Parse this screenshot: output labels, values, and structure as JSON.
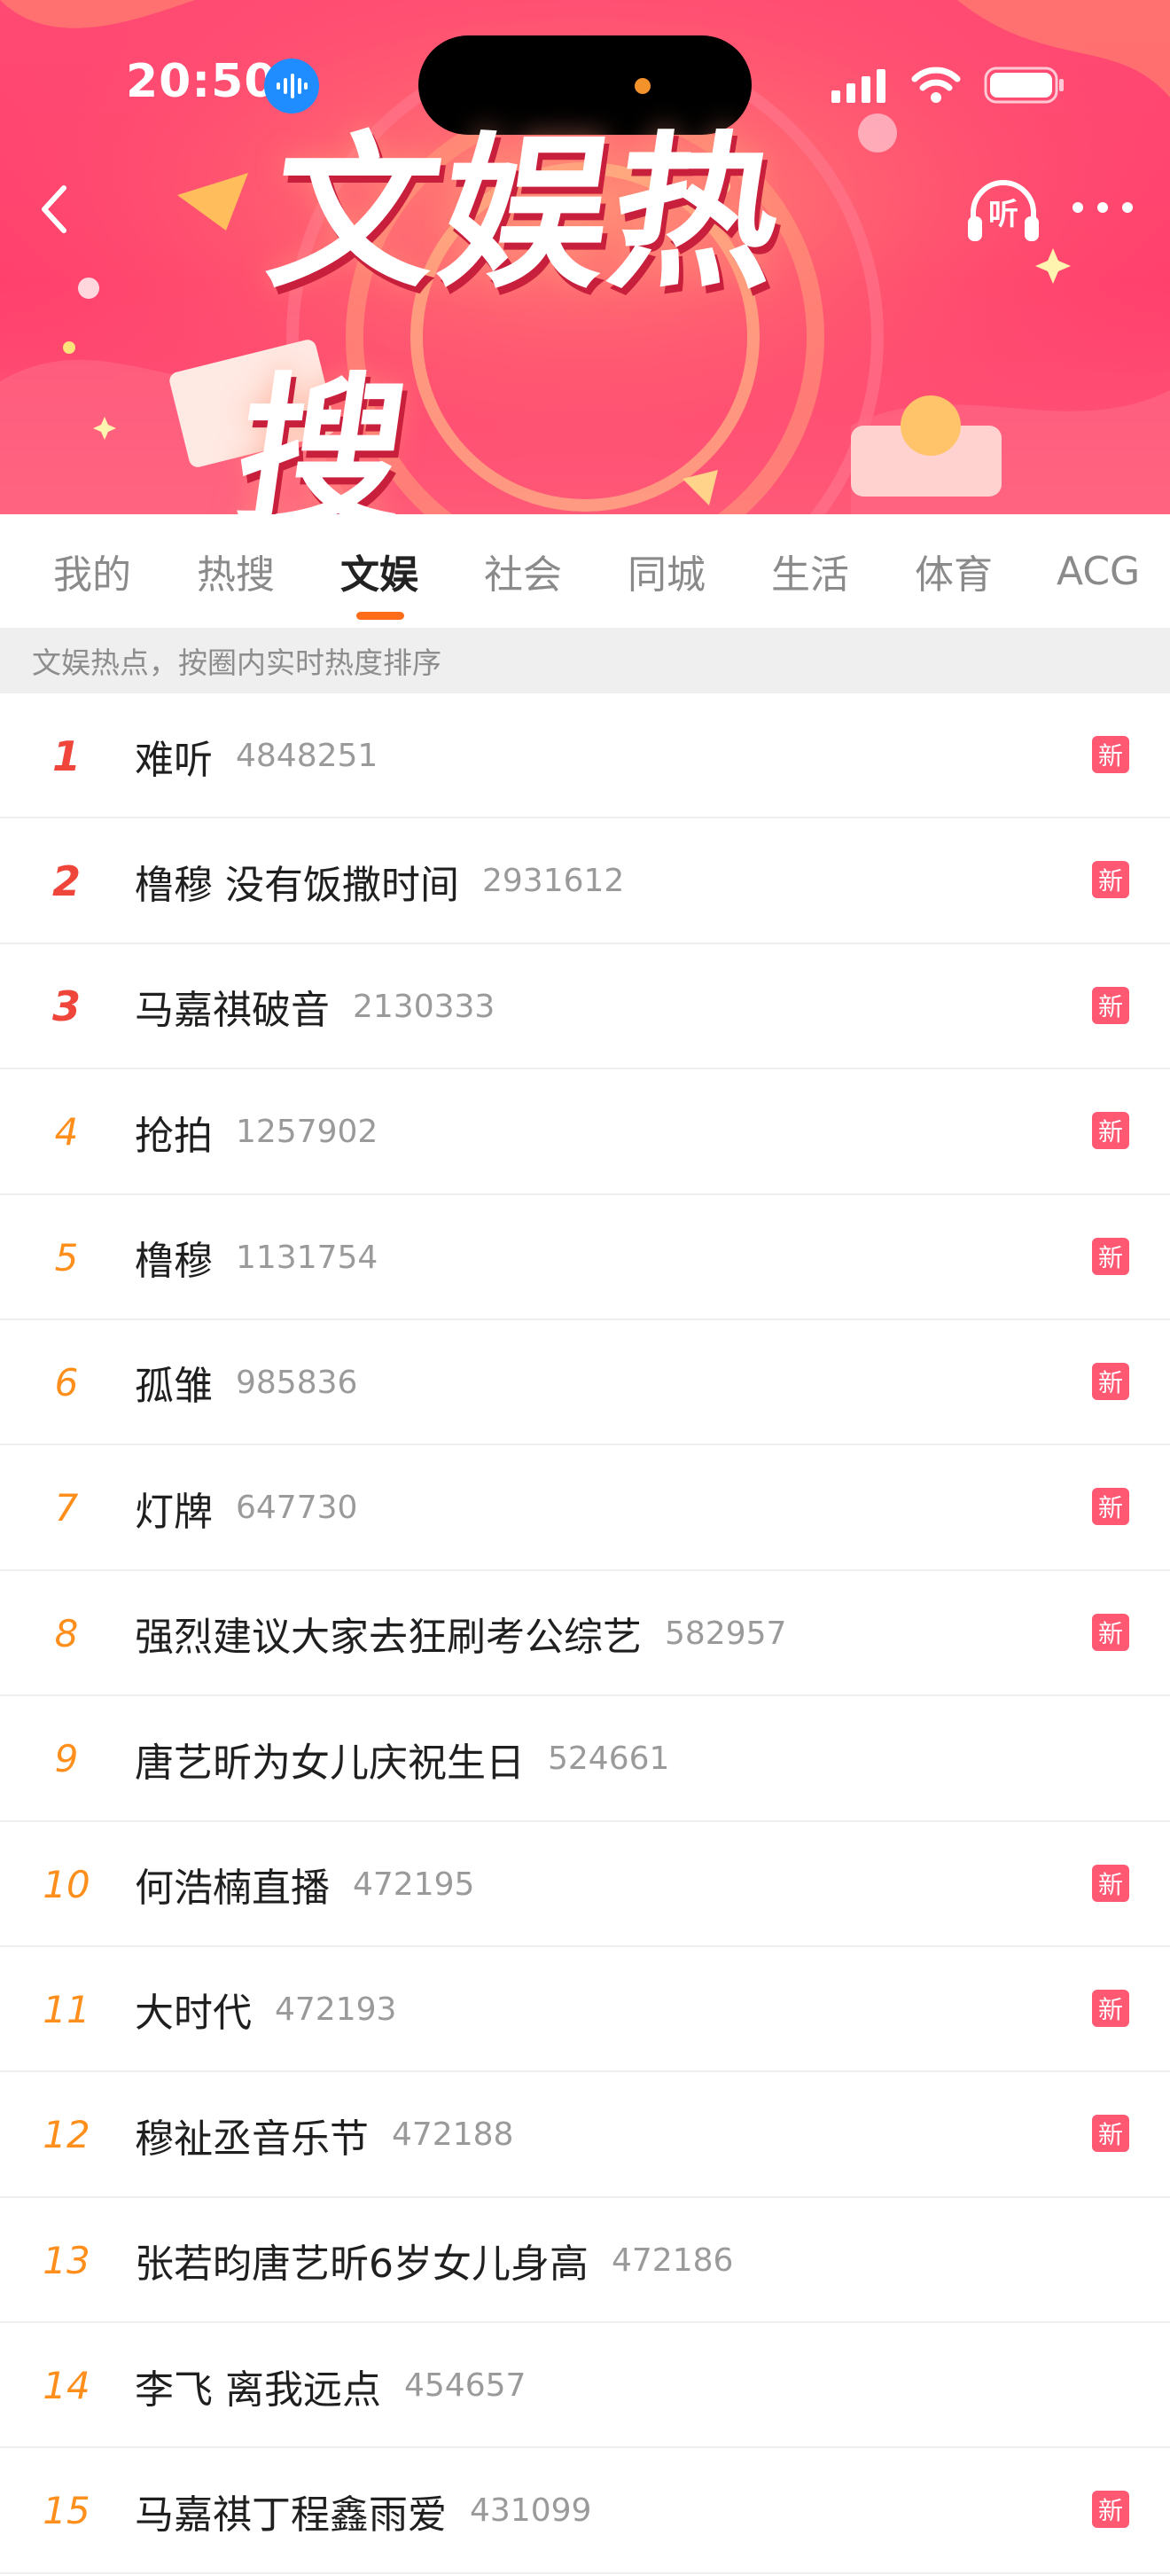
{
  "status_bar": {
    "time": "20:50",
    "icons": [
      "voice-wave-icon",
      "signal-icon",
      "wifi-icon",
      "battery-icon"
    ]
  },
  "header": {
    "title": "文娱热搜",
    "back_icon": "chevron-left-icon",
    "listen_label": "听",
    "more_icon": "more-dots-icon"
  },
  "tabs": [
    {
      "label": "我的",
      "active": false
    },
    {
      "label": "热搜",
      "active": false
    },
    {
      "label": "文娱",
      "active": true
    },
    {
      "label": "社会",
      "active": false
    },
    {
      "label": "同城",
      "active": false
    },
    {
      "label": "生活",
      "active": false
    },
    {
      "label": "体育",
      "active": false
    },
    {
      "label": "ACG",
      "active": false
    }
  ],
  "hint": "文娱热点，按圈内实时热度排序",
  "badge_label": "新",
  "items": [
    {
      "rank": "1",
      "title": "难听",
      "count": "4848251",
      "new": true
    },
    {
      "rank": "2",
      "title": "橹穆 没有饭撒时间",
      "count": "2931612",
      "new": true
    },
    {
      "rank": "3",
      "title": "马嘉祺破音",
      "count": "2130333",
      "new": true
    },
    {
      "rank": "4",
      "title": "抢拍",
      "count": "1257902",
      "new": true
    },
    {
      "rank": "5",
      "title": "橹穆",
      "count": "1131754",
      "new": true
    },
    {
      "rank": "6",
      "title": "孤雏",
      "count": "985836",
      "new": true
    },
    {
      "rank": "7",
      "title": "灯牌",
      "count": "647730",
      "new": true
    },
    {
      "rank": "8",
      "title": "强烈建议大家去狂刷考公综艺",
      "count": "582957",
      "new": true
    },
    {
      "rank": "9",
      "title": "唐艺昕为女儿庆祝生日",
      "count": "524661",
      "new": false
    },
    {
      "rank": "10",
      "title": "何浩楠直播",
      "count": "472195",
      "new": true
    },
    {
      "rank": "11",
      "title": "大时代",
      "count": "472193",
      "new": true
    },
    {
      "rank": "12",
      "title": "穆祉丞音乐节",
      "count": "472188",
      "new": true
    },
    {
      "rank": "13",
      "title": "张若昀唐艺昕6岁女儿身高",
      "count": "472186",
      "new": false
    },
    {
      "rank": "14",
      "title": "李飞 离我远点",
      "count": "454657",
      "new": false
    },
    {
      "rank": "15",
      "title": "马嘉祺丁程鑫雨爱",
      "count": "431099",
      "new": true
    }
  ],
  "colors": {
    "banner": "#ff4a73",
    "top_rank": "#f0453a",
    "rank": "#ff8f1c",
    "badge": "#ff5873",
    "tab_indicator": "#ff6d1a"
  }
}
